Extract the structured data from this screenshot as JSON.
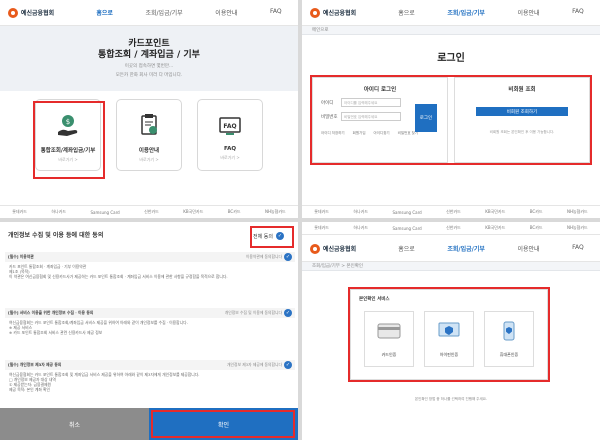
{
  "logo": {
    "text": "예신금융협회"
  },
  "nav": {
    "home": "홈으로",
    "inquiry": "조회/입금/기부",
    "guide": "이용안내",
    "faq": "FAQ"
  },
  "q1": {
    "hero_title_1": "카드포인트",
    "hero_title_2": "통합조회 / 계좌입금 / 기부",
    "hero_sub_1": "이곳의 접속하면 몇번만...",
    "hero_sub_2": "모든카 한화 회사 미러 다 머입니다.",
    "cards": [
      {
        "label": "통합조회/계좌입금/기부",
        "sub": "바로가기 >"
      },
      {
        "label": "이용안내",
        "sub": "바로가기 >"
      },
      {
        "label": "FAQ",
        "sub": "바로가기 >"
      }
    ]
  },
  "q2": {
    "breadcrumb": "메인으로",
    "title": "로그인",
    "id_login": {
      "title": "아이디 로그인",
      "id_label": "아이디",
      "id_placeholder": "아이디를 입력해주세요",
      "pw_label": "비밀번호",
      "pw_placeholder": "비밀번호 입력해주세요",
      "button": "로그인",
      "save_id": "아이디 저장하기",
      "join": "회원가입",
      "find_id": "아이디찾기",
      "find_pw": "비밀번호 찾기"
    },
    "nonmember": {
      "title": "비회원 조회",
      "button": "비회원 조회하기",
      "note": "비회원 조회는 본인확인 후 이용 가능합니다."
    }
  },
  "q3": {
    "title": "개인정보 수집 및 이용 등에 대한 동의",
    "agree_all": "전체 동의",
    "sections": [
      {
        "head": "[필수] 이용약관",
        "right": "이용약관에 동의합니다",
        "body": [
          "카드 포인트 통합조회 · 계좌입금 · 기부 이용약관",
          "제1조 (목적)",
          "이 약관은 여신금융협회 및 신용카드사가 제공하는 카드 포인트 통합조회 · 계좌입금 서비스 이용에 관한 사항을 규정함을 목적으로 합니다."
        ]
      },
      {
        "head": "[필수] 서비스 이용을 위한 개인정보 수집 · 이용 동의",
        "right": "개인정보 수집 및 이용에 동의합니다",
        "body": [
          "여신금융협회는 카드 포인트 통합조회/계좌입금 서비스 제공을 위하여 아래와 같이 개인정보를 수집 · 이용합니다.",
          "※ 제공 서비스",
          "※ 카드 포인트 통합조회 서비스 관련 신용카드사 제공 정보"
        ]
      },
      {
        "head": "[필수] 개인정보 제3자 제공 동의",
        "right": "개인정보 제3자 제공에 동의합니다",
        "body": [
          "여신금융협회는 카드 포인트 통합조회 및 계좌입금 서비스 제공을 위하여 아래와 같이 제3자에게 개인정보를 제공합니다.",
          "□ 개인정보 제공자 대상 내역",
          "① 제공받는자: 금융결제원",
          "제공 목적: 본인 계좌 확인"
        ]
      }
    ],
    "cancel": "취소",
    "confirm": "확인"
  },
  "q4": {
    "breadcrumb": "조회/입금/기부 > 본인확인",
    "verify_title": "본인확인 서비스",
    "options": [
      {
        "label": "카드인증"
      },
      {
        "label": "아이핀인증"
      },
      {
        "label": "휴대폰인증"
      }
    ],
    "note": "본인확인 방법 중 하나를 선택하여 진행해 주세요."
  },
  "sponsors": [
    "롯데카드",
    "하나카드",
    "Samsung Card",
    "신한카드",
    "KB국민카드",
    "BC카드",
    "NH농협카드",
    "우리카드",
    "현대카드",
    "씨티카드"
  ],
  "colors": {
    "accent": "#1f6fc1",
    "highlight": "#e52b2b",
    "brand": "#e85a1b"
  }
}
